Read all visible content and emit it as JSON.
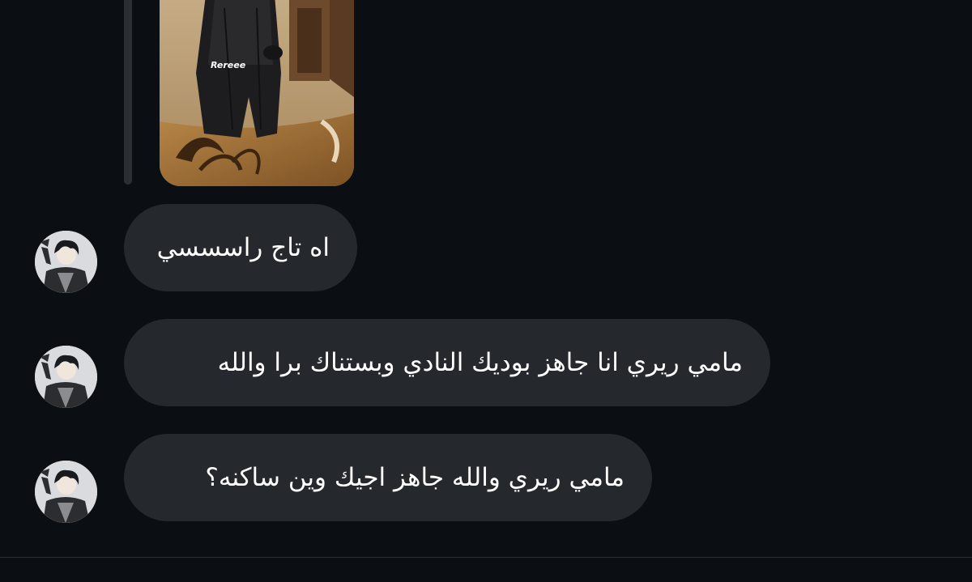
{
  "thread": {
    "image_caption": "Rereee",
    "messages": [
      {
        "text": "اه تاج راسسسي"
      },
      {
        "text": "مامي ريري انا جاهز بوديك النادي وبستناك برا والله"
      },
      {
        "text": "مامي ريري والله جاهز اجيك وين ساكنه؟"
      }
    ]
  },
  "icons": {
    "avatar": "user-avatar-illustration"
  },
  "colors": {
    "background": "#0b0e12",
    "bubble": "#25282c",
    "text": "#ffffff",
    "thread_line": "#2b2f34"
  }
}
